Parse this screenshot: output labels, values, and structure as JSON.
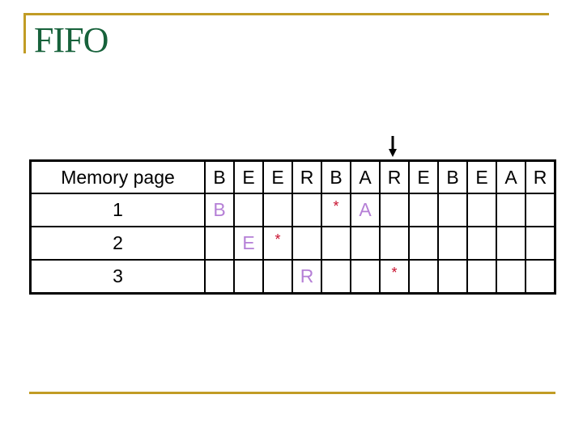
{
  "title": "FIFO",
  "colors": {
    "rule": "#c19c25",
    "title": "#17623b",
    "loaded_page": "#b57fd6",
    "replace_marker": "#c8102e"
  },
  "pointer": {
    "icon": "down-arrow-icon",
    "column_index": 6
  },
  "table": {
    "header_label": "Memory page",
    "reference_string": [
      "B",
      "E",
      "E",
      "R",
      "B",
      "A",
      "R",
      "E",
      "B",
      "E",
      "A",
      "R"
    ],
    "rows": [
      {
        "label": "1",
        "cells": [
          "B",
          "",
          "",
          "",
          "*",
          "A",
          "",
          "",
          "",
          "",
          "",
          ""
        ]
      },
      {
        "label": "2",
        "cells": [
          "",
          "E",
          "*",
          "",
          "",
          "",
          "",
          "",
          "",
          "",
          "",
          ""
        ]
      },
      {
        "label": "3",
        "cells": [
          "",
          "",
          "",
          "R",
          "",
          "",
          "*",
          "",
          "",
          "",
          "",
          ""
        ]
      }
    ]
  }
}
